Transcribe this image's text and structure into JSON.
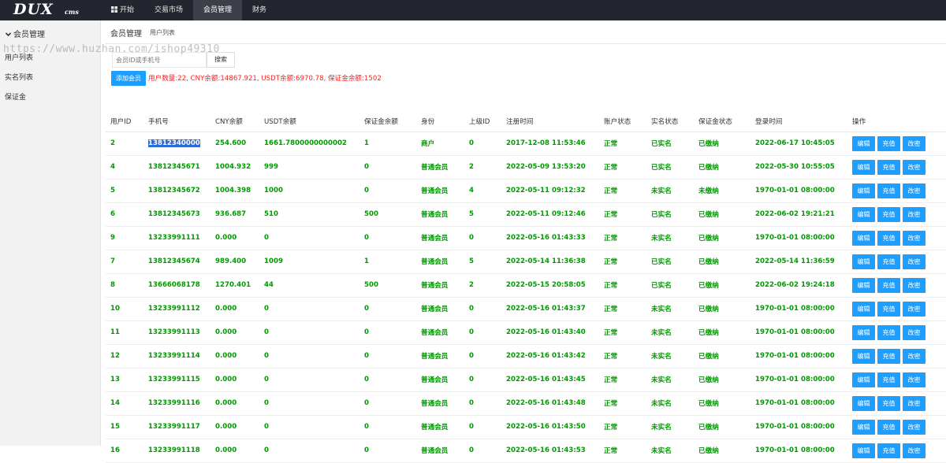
{
  "logo": {
    "main": "DUX",
    "sub": "cms"
  },
  "nav": [
    {
      "label": "开始",
      "icon": "windows-icon"
    },
    {
      "label": "交易市场"
    },
    {
      "label": "会员管理"
    },
    {
      "label": "财务"
    }
  ],
  "sidebar": {
    "title": "会员管理",
    "items": [
      {
        "label": "用户列表"
      },
      {
        "label": "实名列表"
      },
      {
        "label": "保证金"
      }
    ]
  },
  "breadcrumb": {
    "main": "会员管理",
    "sub": "用户列表"
  },
  "search": {
    "placeholder": "会员ID或手机号",
    "button": "搜索"
  },
  "add_button": "添加会员",
  "stats": "用户数量:22, CNY余额:14867.921, USDT余额:6970.78, 保证金余额:1502",
  "watermark": "https://www.huzhan.com/ishop49310",
  "table": {
    "headers": [
      "用户ID",
      "手机号",
      "CNY余额",
      "USDT余额",
      "保证金余额",
      "身份",
      "上级ID",
      "注册时间",
      "账户状态",
      "实名状态",
      "保证金状态",
      "登录时间",
      "操作"
    ],
    "actions": [
      "编辑",
      "充值",
      "改密"
    ],
    "rows": [
      [
        "2",
        "13812340000",
        "254.600",
        "1661.7800000000002",
        "1",
        "商户",
        "0",
        "2017-12-08 11:53:46",
        "正常",
        "已实名",
        "已缴纳",
        "2022-06-17 10:45:05"
      ],
      [
        "4",
        "13812345671",
        "1004.932",
        "999",
        "0",
        "普通会员",
        "2",
        "2022-05-09 13:53:20",
        "正常",
        "已实名",
        "已缴纳",
        "2022-05-30 10:55:05"
      ],
      [
        "5",
        "13812345672",
        "1004.398",
        "1000",
        "0",
        "普通会员",
        "4",
        "2022-05-11 09:12:32",
        "正常",
        "未实名",
        "未缴纳",
        "1970-01-01 08:00:00"
      ],
      [
        "6",
        "13812345673",
        "936.687",
        "510",
        "500",
        "普通会员",
        "5",
        "2022-05-11 09:12:46",
        "正常",
        "已实名",
        "已缴纳",
        "2022-06-02 19:21:21"
      ],
      [
        "9",
        "13233991111",
        "0.000",
        "0",
        "0",
        "普通会员",
        "0",
        "2022-05-16 01:43:33",
        "正常",
        "未实名",
        "已缴纳",
        "1970-01-01 08:00:00"
      ],
      [
        "7",
        "13812345674",
        "989.400",
        "1009",
        "1",
        "普通会员",
        "5",
        "2022-05-14 11:36:38",
        "正常",
        "已实名",
        "已缴纳",
        "2022-05-14 11:36:59"
      ],
      [
        "8",
        "13666068178",
        "1270.401",
        "44",
        "500",
        "普通会员",
        "2",
        "2022-05-15 20:58:05",
        "正常",
        "已实名",
        "已缴纳",
        "2022-06-02 19:24:18"
      ],
      [
        "10",
        "13233991112",
        "0.000",
        "0",
        "0",
        "普通会员",
        "0",
        "2022-05-16 01:43:37",
        "正常",
        "未实名",
        "已缴纳",
        "1970-01-01 08:00:00"
      ],
      [
        "11",
        "13233991113",
        "0.000",
        "0",
        "0",
        "普通会员",
        "0",
        "2022-05-16 01:43:40",
        "正常",
        "未实名",
        "已缴纳",
        "1970-01-01 08:00:00"
      ],
      [
        "12",
        "13233991114",
        "0.000",
        "0",
        "0",
        "普通会员",
        "0",
        "2022-05-16 01:43:42",
        "正常",
        "未实名",
        "已缴纳",
        "1970-01-01 08:00:00"
      ],
      [
        "13",
        "13233991115",
        "0.000",
        "0",
        "0",
        "普通会员",
        "0",
        "2022-05-16 01:43:45",
        "正常",
        "未实名",
        "已缴纳",
        "1970-01-01 08:00:00"
      ],
      [
        "14",
        "13233991116",
        "0.000",
        "0",
        "0",
        "普通会员",
        "0",
        "2022-05-16 01:43:48",
        "正常",
        "未实名",
        "已缴纳",
        "1970-01-01 08:00:00"
      ],
      [
        "15",
        "13233991117",
        "0.000",
        "0",
        "0",
        "普通会员",
        "0",
        "2022-05-16 01:43:50",
        "正常",
        "未实名",
        "已缴纳",
        "1970-01-01 08:00:00"
      ],
      [
        "16",
        "13233991118",
        "0.000",
        "0",
        "0",
        "普通会员",
        "0",
        "2022-05-16 01:43:53",
        "正常",
        "未实名",
        "已缴纳",
        "1970-01-01 08:00:00"
      ]
    ]
  },
  "colors": {
    "topbar": "#23262e",
    "active_nav": "#3d4049",
    "button": "#1e9fff",
    "data_text": "#009900",
    "stats_text": "#ff2222"
  }
}
